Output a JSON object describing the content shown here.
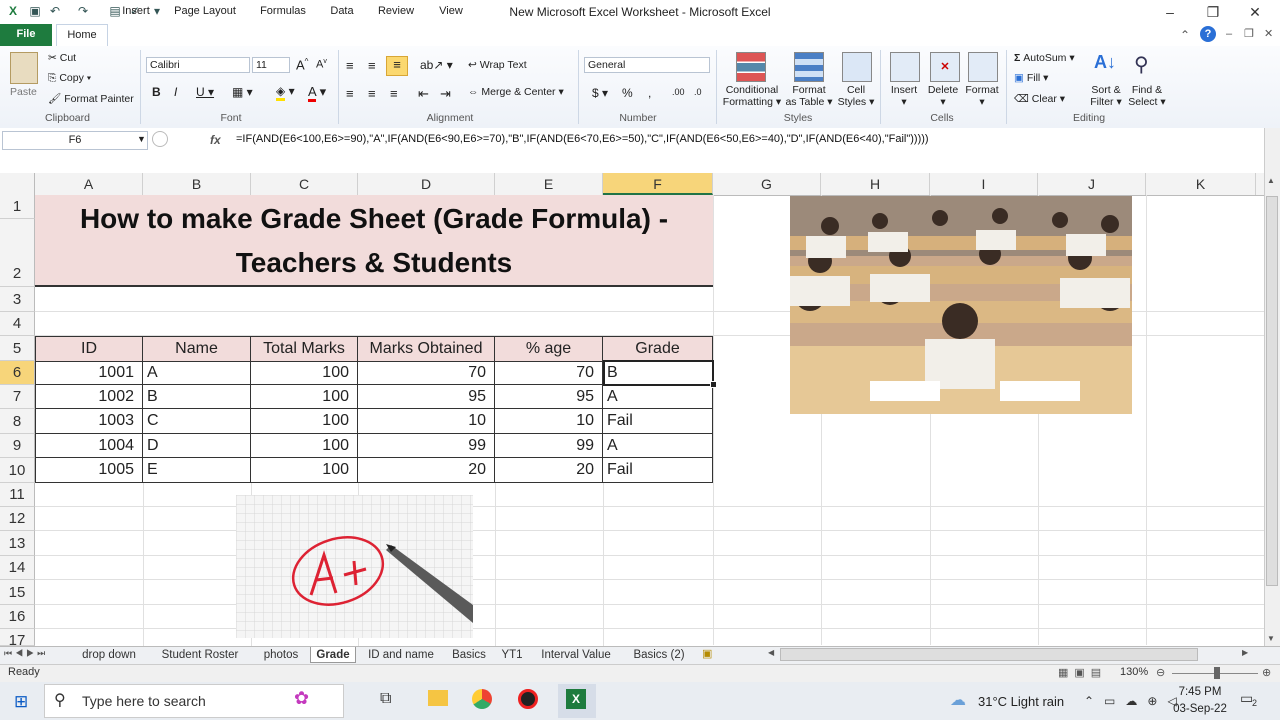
{
  "window": {
    "title": "New Microsoft Excel Worksheet  -  Microsoft Excel"
  },
  "ribbon": {
    "tabs": [
      "File",
      "Home",
      "Insert",
      "Page Layout",
      "Formulas",
      "Data",
      "Review",
      "View"
    ],
    "clipboard": {
      "paste": "Paste",
      "cut": "Cut",
      "copy": "Copy",
      "format_painter": "Format Painter",
      "label": "Clipboard"
    },
    "font": {
      "name": "Calibri",
      "size": "11",
      "label": "Font"
    },
    "alignment": {
      "wrap_text": "Wrap Text",
      "merge_center": "Merge & Center",
      "label": "Alignment"
    },
    "number": {
      "format": "General",
      "label": "Number"
    },
    "styles": {
      "conditional": "Conditional",
      "conditional2": "Formatting",
      "format_table": "Format",
      "format_table2": "as Table",
      "cell_styles": "Cell",
      "cell_styles2": "Styles",
      "label": "Styles"
    },
    "cells": {
      "insert": "Insert",
      "delete": "Delete",
      "format": "Format",
      "label": "Cells"
    },
    "editing": {
      "autosum": "AutoSum",
      "fill": "Fill",
      "clear": "Clear",
      "sort": "Sort &",
      "sort2": "Filter",
      "find": "Find &",
      "find2": "Select",
      "label": "Editing"
    }
  },
  "formula_bar": {
    "name_box": "F6",
    "fx": "fx",
    "formula": "=IF(AND(E6<100,E6>=90),\"A\",IF(AND(E6<90,E6>=70),\"B\",IF(AND(E6<70,E6>=50),\"C\",IF(AND(E6<50,E6>=40),\"D\",IF(AND(E6<40),\"Fail\")))))"
  },
  "grid": {
    "columns": [
      "A",
      "B",
      "C",
      "D",
      "E",
      "F",
      "G",
      "H",
      "I",
      "J",
      "K"
    ],
    "rows": [
      "1",
      "2",
      "3",
      "4",
      "5",
      "6",
      "7",
      "8",
      "9",
      "10",
      "11",
      "12",
      "13",
      "14",
      "15",
      "16",
      "17"
    ],
    "selected_cell": "F6",
    "title_line1": "How to make Grade Sheet (Grade Formula) -",
    "title_line2": "Teachers & Students",
    "table": {
      "headers": [
        "ID",
        "Name",
        "Total Marks",
        "Marks Obtained",
        "% age",
        "Grade"
      ],
      "rows": [
        [
          "1001",
          "A",
          "100",
          "70",
          "70",
          "B"
        ],
        [
          "1002",
          "B",
          "100",
          "95",
          "95",
          "A"
        ],
        [
          "1003",
          "C",
          "100",
          "10",
          "10",
          "Fail"
        ],
        [
          "1004",
          "D",
          "100",
          "99",
          "99",
          "A"
        ],
        [
          "1005",
          "E",
          "100",
          "20",
          "20",
          "Fail"
        ]
      ]
    }
  },
  "sheets": [
    "drop down",
    "Student Roster",
    "photos",
    "Grade",
    "ID and name",
    "Basics",
    "YT1",
    "Interval Value",
    "Basics (2)"
  ],
  "active_sheet": "Grade",
  "status": {
    "ready": "Ready",
    "zoom": "130%"
  },
  "taskbar": {
    "search_placeholder": "Type here to search",
    "weather": "31°C  Light rain",
    "time": "7:45 PM",
    "date": "03-Sep-22",
    "notifications": "2"
  },
  "colors": {
    "header_fill": "#f2dcdb",
    "excel_green": "#1e7b3e",
    "selection": "#f7d57a"
  }
}
